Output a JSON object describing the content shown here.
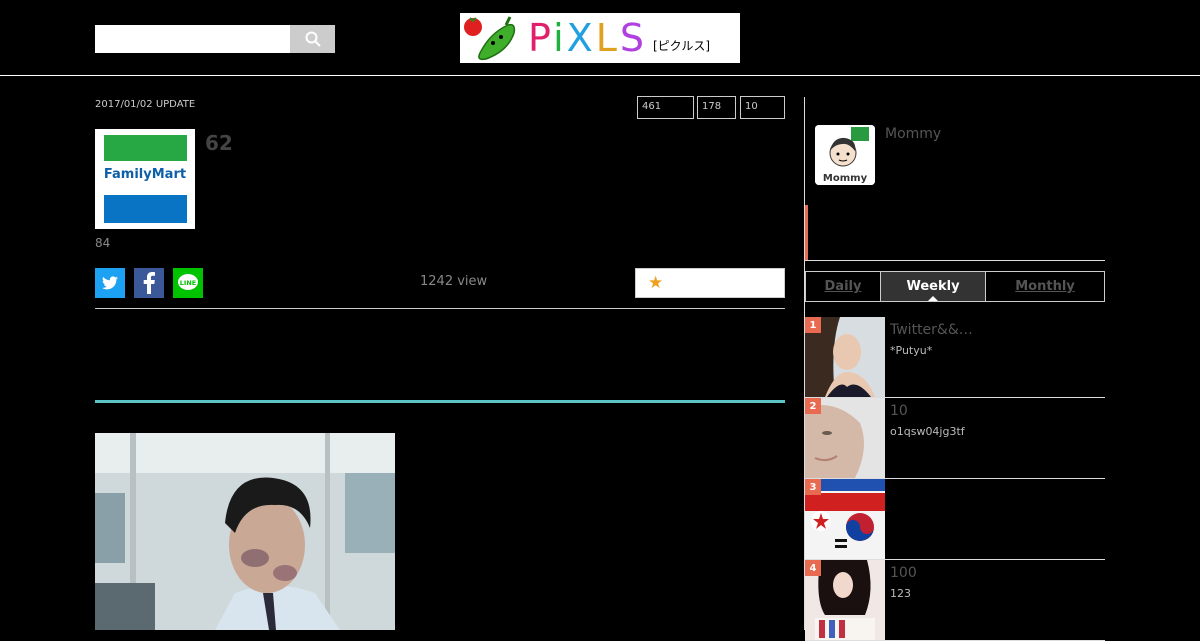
{
  "search": {
    "placeholder": "",
    "value": ""
  },
  "logo": {
    "text": "PiXLS",
    "sub": "[ピクルス]"
  },
  "article": {
    "update_date": "2017/01/02 UPDATE",
    "counts": [
      "461",
      "178",
      "10"
    ],
    "store_logo_text": "FamilyMart",
    "rank_number": "62",
    "sub_number": "84",
    "views": "1242 view"
  },
  "sidebar": {
    "user_name": "Mommy",
    "avatar_text": "Mommy",
    "tabs": [
      {
        "label": "Daily",
        "active": false
      },
      {
        "label": "Weekly",
        "active": true
      },
      {
        "label": "Monthly",
        "active": false
      }
    ],
    "ranking": [
      {
        "rank": "1",
        "title": "Twitter&&…",
        "user": "*Putyu*"
      },
      {
        "rank": "2",
        "title": "10",
        "user": "o1qsw04jg3tf"
      },
      {
        "rank": "3",
        "title": "",
        "user": ""
      },
      {
        "rank": "4",
        "title": "100",
        "user": "123"
      }
    ]
  },
  "colors": {
    "accent": "#e86a50",
    "teal": "#5cc4c4",
    "star": "#f0a020",
    "twitter": "#1da1f2",
    "facebook": "#3b5998",
    "line": "#00c300"
  }
}
